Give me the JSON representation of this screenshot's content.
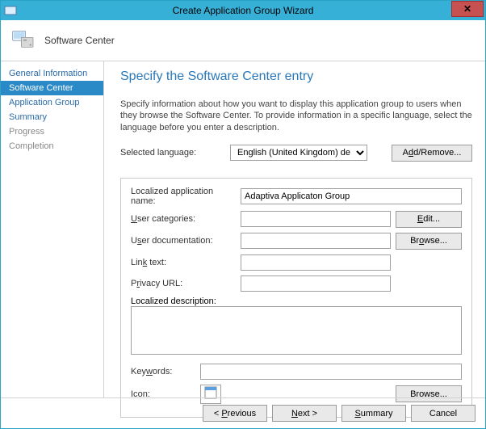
{
  "window": {
    "title": "Create Application Group Wizard"
  },
  "header": {
    "label": "Software Center"
  },
  "sidebar": {
    "items": [
      {
        "label": "General Information"
      },
      {
        "label": "Software Center"
      },
      {
        "label": "Application Group"
      },
      {
        "label": "Summary"
      },
      {
        "label": "Progress"
      },
      {
        "label": "Completion"
      }
    ]
  },
  "page": {
    "title": "Specify the Software Center entry",
    "intro": "Specify information about how you want to display this application group to users when they browse the Software Center. To provide information in a specific language, select the language before you enter a description."
  },
  "lang": {
    "label": "Selected language:",
    "value": "English (United Kingdom) default",
    "button": "Add/Remove..."
  },
  "fields": {
    "appname_label": "Localized application name:",
    "appname_value": "Adaptiva Applicaton Group",
    "usercat_label": "User categories:",
    "usercat_value": "",
    "edit_btn": "Edit...",
    "userdoc_label": "User documentation:",
    "userdoc_value": "",
    "browse_btn": "Browse...",
    "linktext_label": "Link text:",
    "linktext_value": "",
    "privacy_label": "Privacy URL:",
    "privacy_value": "",
    "desc_label": "Localized description:",
    "desc_value": "",
    "keywords_label": "Keywords:",
    "keywords_value": "",
    "icon_label": "Icon:"
  },
  "footer": {
    "prev": "Previous",
    "next": "Next >",
    "summary": "Summary",
    "cancel": "Cancel"
  }
}
